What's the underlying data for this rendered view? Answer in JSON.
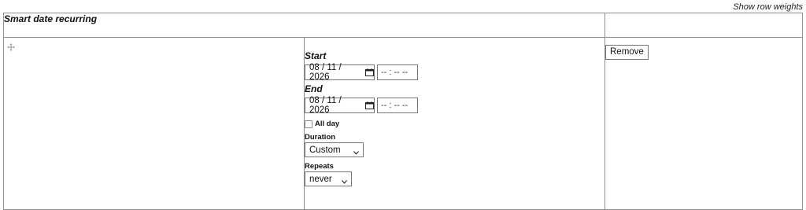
{
  "header": {
    "show_row_weights": "Show row weights"
  },
  "field": {
    "title": "Smart date recurring"
  },
  "item": {
    "start": {
      "label": "Start",
      "date_value": "08 / 11 / 2026",
      "time_placeholder": "-- : --  --"
    },
    "end": {
      "label": "End",
      "date_value": "08 / 11 / 2026",
      "time_placeholder": "-- : --  --"
    },
    "all_day": {
      "label": "All day",
      "checked": false
    },
    "duration": {
      "label": "Duration",
      "selected": "Custom"
    },
    "repeats": {
      "label": "Repeats",
      "selected": "never"
    },
    "remove_label": "Remove"
  },
  "icons": {
    "drag": "drag-handle-icon",
    "calendar": "calendar-icon",
    "dropdown": "chevron-down-icon"
  }
}
